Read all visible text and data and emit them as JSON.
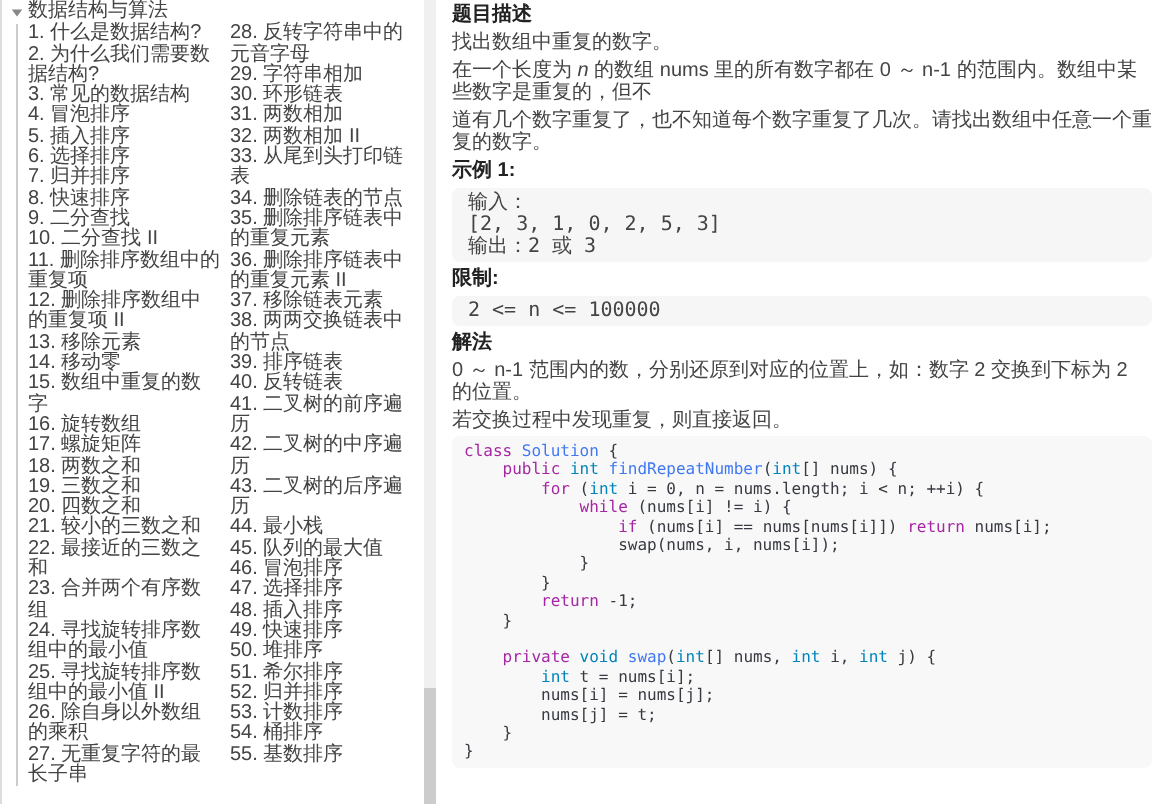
{
  "sidebar": {
    "items": [
      {
        "label": "数据结构与算法",
        "expanded": true,
        "children": [
          {
            "label": "1. 什么是数据结构?"
          },
          {
            "label": "2. 为什么我们需要数据结构?"
          },
          {
            "label": "3. 常见的数据结构"
          },
          {
            "label": "4. 冒泡排序"
          },
          {
            "label": "5. 插入排序"
          },
          {
            "label": "6. 选择排序"
          },
          {
            "label": "7. 归并排序"
          },
          {
            "label": "8. 快速排序"
          },
          {
            "label": "9. 二分查找"
          },
          {
            "label": "10. 二分查找 II"
          },
          {
            "label": "11. 删除排序数组中的重复项"
          },
          {
            "label": "12. 删除排序数组中的重复项 II"
          },
          {
            "label": "13. 移除元素"
          },
          {
            "label": "14. 移动零"
          },
          {
            "label": "15. 数组中重复的数字"
          },
          {
            "label": "16. 旋转数组"
          },
          {
            "label": "17. 螺旋矩阵"
          },
          {
            "label": "18. 两数之和"
          },
          {
            "label": "19. 三数之和"
          },
          {
            "label": "20. 四数之和"
          },
          {
            "label": "21. 较小的三数之和"
          },
          {
            "label": "22. 最接近的三数之和"
          },
          {
            "label": "23. 合并两个有序数组"
          },
          {
            "label": "24. 寻找旋转排序数组中的最小值"
          },
          {
            "label": "25. 寻找旋转排序数组中的最小值 II"
          },
          {
            "label": "26. 除自身以外数组的乘积"
          },
          {
            "label": "27. 无重复字符的最长子串"
          },
          {
            "label": "28. 反转字符串中的元音字母"
          },
          {
            "label": "29. 字符串相加"
          },
          {
            "label": "30. 环形链表"
          },
          {
            "label": "31. 两数相加"
          },
          {
            "label": "32. 两数相加 II"
          },
          {
            "label": "33. 从尾到头打印链表"
          },
          {
            "label": "34. 删除链表的节点"
          },
          {
            "label": "35. 删除排序链表中的重复元素"
          },
          {
            "label": "36. 删除排序链表中的重复元素 II"
          },
          {
            "label": "37. 移除链表元素"
          },
          {
            "label": "38. 两两交换链表中的节点"
          },
          {
            "label": "39. 排序链表"
          },
          {
            "label": "40. 反转链表"
          },
          {
            "label": "41. 二叉树的前序遍历"
          },
          {
            "label": "42. 二叉树的中序遍历"
          },
          {
            "label": "43. 二叉树的后序遍历"
          },
          {
            "label": "44. 最小栈"
          },
          {
            "label": "45. 队列的最大值"
          },
          {
            "label": "46. 冒泡排序"
          },
          {
            "label": "47. 选择排序"
          },
          {
            "label": "48. 插入排序"
          },
          {
            "label": "49. 快速排序"
          },
          {
            "label": "50. 堆排序"
          },
          {
            "label": "51. 希尔排序"
          },
          {
            "label": "52. 归并排序"
          },
          {
            "label": "53. 计数排序"
          },
          {
            "label": "54. 桶排序"
          },
          {
            "label": "55. 基数排序"
          }
        ]
      }
    ]
  },
  "article": {
    "blocks": [
      {
        "kind": "heading",
        "text": "题目描述"
      },
      {
        "kind": "paragraph",
        "text": "找出数组中重复的数字。"
      },
      {
        "kind": "paragraph",
        "text": "在一个长度为 *n* 的数组 nums 里的所有数字都在 0 ～ n-1 的范围内。数组中某些数字是重复的，但不"
      },
      {
        "kind": "paragraph",
        "text": "道有几个数字重复了，也不知道每个数字重复了几次。请找出数组中任意一个重复的数字。"
      },
      {
        "kind": "heading",
        "text": "示例 1:"
      },
      {
        "kind": "example",
        "lines": [
          "输入：",
          "[2, 3, 1, 0, 2, 5, 3]",
          "输出：2 或 3"
        ]
      },
      {
        "kind": "heading",
        "text": "限制:"
      },
      {
        "kind": "example",
        "lines": [
          "2 <= n <= 100000"
        ]
      },
      {
        "kind": "heading",
        "text": "解法"
      },
      {
        "kind": "paragraph",
        "text": "0 ～ n-1 范围内的数，分别还原到对应的位置上，如：数字 2 交换到下标为 2 的位置。"
      },
      {
        "kind": "paragraph",
        "text": "若交换过程中发现重复，则直接返回。"
      },
      {
        "kind": "code",
        "lines": [
          {
            "tokens": [
              {
                "kind": "keyword",
                "text": "class "
              },
              {
                "kind": "name",
                "text": "Solution"
              },
              {
                "kind": "plain",
                "text": " {"
              }
            ]
          },
          {
            "tokens": [
              {
                "kind": "keyword",
                "text": "    public "
              },
              {
                "kind": "type",
                "text": "int "
              },
              {
                "kind": "name",
                "text": "findRepeatNumber"
              },
              {
                "kind": "plain",
                "text": "("
              },
              {
                "kind": "type",
                "text": "int"
              },
              {
                "kind": "plain",
                "text": "[] nums) {"
              }
            ]
          },
          {
            "tokens": [
              {
                "kind": "keyword",
                "text": "        for "
              },
              {
                "kind": "plain",
                "text": "("
              },
              {
                "kind": "type",
                "text": "int"
              },
              {
                "kind": "plain",
                "text": " i = 0, n = nums.length; i < n; ++i) {"
              }
            ]
          },
          {
            "tokens": [
              {
                "kind": "keyword",
                "text": "            while "
              },
              {
                "kind": "plain",
                "text": "(nums[i] != i) {"
              }
            ]
          },
          {
            "tokens": [
              {
                "kind": "keyword",
                "text": "                if "
              },
              {
                "kind": "plain",
                "text": "(nums[i] == nums[nums[i]]) "
              },
              {
                "kind": "keyword",
                "text": "return "
              },
              {
                "kind": "plain",
                "text": "nums[i];"
              }
            ]
          },
          {
            "tokens": [
              {
                "kind": "plain",
                "text": "                swap(nums, i, nums[i]);"
              }
            ]
          },
          {
            "tokens": [
              {
                "kind": "plain",
                "text": "            }"
              }
            ]
          },
          {
            "tokens": [
              {
                "kind": "plain",
                "text": "        }"
              }
            ]
          },
          {
            "tokens": [
              {
                "kind": "keyword",
                "text": "        return "
              },
              {
                "kind": "plain",
                "text": "-1;"
              }
            ]
          },
          {
            "tokens": [
              {
                "kind": "plain",
                "text": "    }"
              }
            ]
          },
          {
            "gap_before": true,
            "tokens": [
              {
                "kind": "keyword",
                "text": "    private "
              },
              {
                "kind": "type",
                "text": "void "
              },
              {
                "kind": "name",
                "text": "swap"
              },
              {
                "kind": "plain",
                "text": "("
              },
              {
                "kind": "type",
                "text": "int"
              },
              {
                "kind": "plain",
                "text": "[] nums, "
              },
              {
                "kind": "type",
                "text": "int "
              },
              {
                "kind": "plain",
                "text": "i, "
              },
              {
                "kind": "type",
                "text": "int "
              },
              {
                "kind": "plain",
                "text": "j) {"
              }
            ]
          },
          {
            "tokens": [
              {
                "kind": "type",
                "text": "        int "
              },
              {
                "kind": "plain",
                "text": "t = nums[i];"
              }
            ]
          },
          {
            "tokens": [
              {
                "kind": "plain",
                "text": "        nums[i] = nums[j];"
              }
            ]
          },
          {
            "tokens": [
              {
                "kind": "plain",
                "text": "        nums[j] = t;"
              }
            ]
          },
          {
            "tokens": [
              {
                "kind": "plain",
                "text": "    }"
              }
            ]
          },
          {
            "tokens": [
              {
                "kind": "plain",
                "text": "}"
              }
            ]
          }
        ]
      }
    ]
  }
}
